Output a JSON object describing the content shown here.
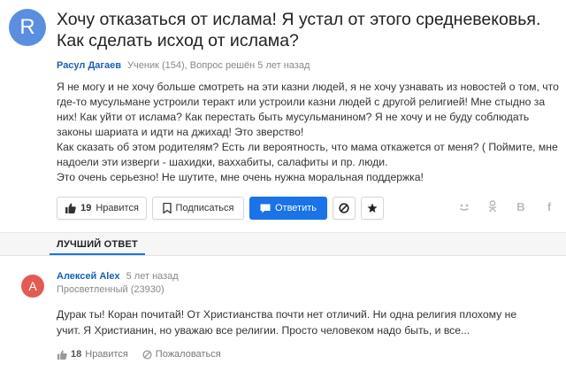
{
  "question": {
    "avatar_letter": "R",
    "title": "Хочу отказаться от ислама! Я устал от этого средневековья. Как сделать исход от ислама?",
    "author": "Расул Дагаев",
    "meta": "Ученик (154), Вопрос решён 5 лет назад",
    "body": [
      "Я не могу и не хочу больше смотреть на эти казни людей, я не хочу узнавать из новостей о том, что где-то мусульмане устроили теракт или устроили казни людей с другой религией! Мне стыдно за них! Как уйти от ислама? Как перестать быть мусульманином? Я не хочу и не буду соблюдать законы шариата и идти на джихад! Это зверство!",
      "Как сказать об этом родителям? Есть ли вероятность, что мама откажется от меня? ( Поймите, мне надоели эти изверги - шахидки, ваххабиты, салафиты и пр. люди.",
      "Это очень серьезно! Не шутите, мне очень нужна моральная поддержка!"
    ],
    "actions": {
      "like_count": "19",
      "like_label": "Нравится",
      "subscribe_label": "Подписаться",
      "answer_label": "Ответить"
    },
    "share_icons": [
      "mail-ru-icon",
      "odnoklassniki-icon",
      "vk-icon",
      "facebook-icon"
    ]
  },
  "best_answer": {
    "section_label": "ЛУЧШИЙ ОТВЕТ",
    "avatar_letter": "А",
    "author": "Алексей Alex",
    "time": "5 лет назад",
    "rank": "Просветленный (23930)",
    "text": "Дурак ты! Коран почитай! От Христианства почти нет отличий. Ни одна религия плохому не учит. Я Христианин, но уважаю все религии. Просто человеком надо быть, и все...",
    "like_count": "18",
    "like_label": "Нравится",
    "report_label": "Пожаловаться"
  },
  "colors": {
    "accent": "#1a73e8",
    "link": "#1a5fb4",
    "question_avatar": "#5a8fe0",
    "answer_avatar": "#e25b52"
  }
}
